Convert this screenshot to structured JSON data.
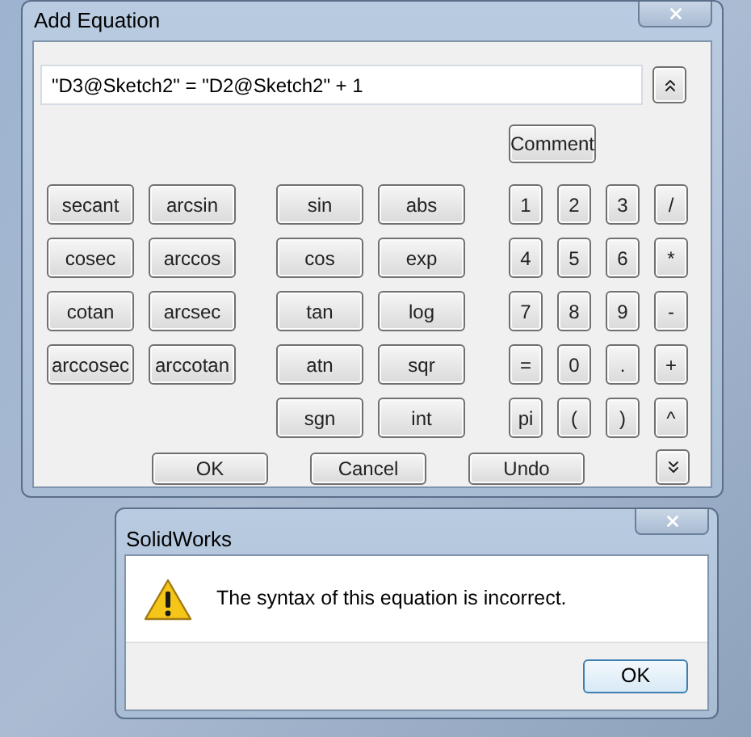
{
  "equation_window": {
    "title": "Add Equation",
    "equation": "\"D3@Sketch2\" = \"D2@Sketch2\" + 1",
    "comment_button": "Comment",
    "keypad": [
      [
        [
          "secant",
          "arcsin"
        ],
        [
          "cosec",
          "arccos"
        ],
        [
          "cotan",
          "arcsec"
        ],
        [
          "arccosec",
          "arccotan"
        ]
      ],
      [
        [
          "sin",
          "abs"
        ],
        [
          "cos",
          "exp"
        ],
        [
          "tan",
          "log"
        ],
        [
          "atn",
          "sqr"
        ],
        [
          "sgn",
          "int"
        ]
      ],
      [
        [
          "1",
          "2",
          "3",
          "/"
        ],
        [
          "4",
          "5",
          "6",
          "*"
        ],
        [
          "7",
          "8",
          "9",
          "-"
        ],
        [
          "=",
          "0",
          ".",
          "+"
        ],
        [
          "pi",
          "(",
          ")",
          "^"
        ]
      ]
    ],
    "actions": [
      "OK",
      "Cancel",
      "Undo"
    ]
  },
  "message_box": {
    "title": "SolidWorks",
    "message": "The syntax of this equation is incorrect.",
    "button": "OK"
  }
}
